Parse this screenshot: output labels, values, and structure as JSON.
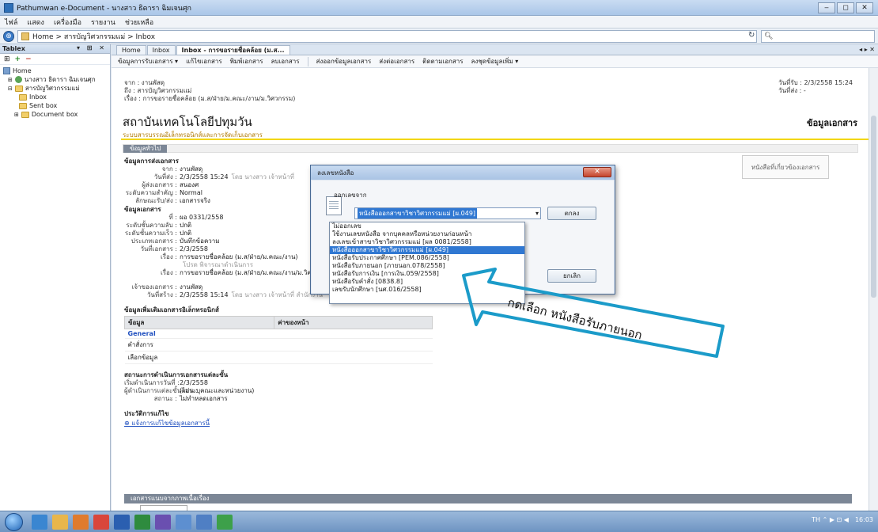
{
  "window": {
    "title": "Pathumwan e-Document - นางสาว ธิดารา ฉิมเจนศุก",
    "controls": [
      "‒",
      "◻",
      "✕"
    ]
  },
  "menubar": [
    "ไฟล์",
    "แสดง",
    "เครื่องมือ",
    "รายงาน",
    "ช่วยเหลือ"
  ],
  "address": {
    "path": "Home > สารบัญวิศวกรรมแม่ > Inbox",
    "search_placeholder": ""
  },
  "leftpane": {
    "header": "Tablex",
    "controls": "▾ ⊞ ✕",
    "toolbar": [
      "⊞",
      "+",
      "−"
    ],
    "tree": [
      {
        "label": "Home",
        "indent": 0,
        "icon": "home-icon"
      },
      {
        "label": "นางสาว ธิดารา ฉิมเจนศุก",
        "indent": 1,
        "icon": "user-icon"
      },
      {
        "label": "สารบัญวิศวกรรมแม่",
        "indent": 1,
        "icon": "folder-icon"
      },
      {
        "label": "Inbox",
        "indent": 2,
        "icon": "folder-icon"
      },
      {
        "label": "Sent box",
        "indent": 2,
        "icon": "folder-icon"
      },
      {
        "label": "Document box",
        "indent": 2,
        "icon": "folder-icon"
      }
    ]
  },
  "tabs": [
    {
      "label": "Home",
      "active": false
    },
    {
      "label": "Inbox",
      "active": false
    },
    {
      "label": "Inbox - การขอรายชื่อคล้อย (ม.ส...",
      "active": true
    }
  ],
  "tab_controls": "◂ ▸ ✕",
  "doctoolbar": [
    "ข้อมูลการรับเอกสาร ▾",
    "แก้ไขเอกสาร",
    "พิมพ์เอกสาร",
    "ลบเอกสาร",
    "ส่งออกข้อมูลเอกสาร",
    "ส่งต่อเอกสาร",
    "ติดตามเอกสาร",
    "ลงชุดข้อมูลเพิ่ม ▾"
  ],
  "meta": {
    "left": [
      "จาก : งานพัสดุ",
      "ถึง : สารบัญวิศวกรรมแม่",
      "เรื่อง : การขอรายชื่อคล้อย (ม.ส/ฝ่าย/ม.คณะ/งาน/ม.วิศวกรรม)"
    ],
    "right": [
      "วันที่รับ : 2/3/2558 15:24",
      "วันที่ส่ง : -"
    ]
  },
  "org": {
    "title": "สถาบันเทคโนโลยีปทุมวัน",
    "subtitle": "ระบบสารบรรณอิเล็กทรอนิกส์และการจัดเก็บเอกสาร",
    "doc_info": "ข้อมูลเอกสาร",
    "section_tag": "ข้อมูลทั่วไป"
  },
  "form": {
    "sec1": "ข้อมูลการส่งเอกสาร",
    "sec1_rows": [
      {
        "label": "จาก :",
        "value": "งานพัสดุ",
        "note": ""
      },
      {
        "label": "วันที่ส่ง :",
        "value": "2/3/2558 15:24",
        "note": "โดย นางสาว เจ้าหน้าที่"
      },
      {
        "label": "ผู้ส่งเอกสาร :",
        "value": "สนองศ",
        "note": ""
      },
      {
        "label": "ระดับความสำคัญ :",
        "value": "Normal",
        "note": ""
      },
      {
        "label": "ลักษณะรับ/ส่ง :",
        "value": "เอกสารจริง",
        "note": ""
      }
    ],
    "sec2": "ข้อมูลเอกสาร",
    "sec2_rows": [
      {
        "label": "ที่ :",
        "value": "ผอ 0331/2558",
        "note": ""
      },
      {
        "label": "ระดับชั้นความลับ :",
        "value": "ปกติ",
        "note": ""
      },
      {
        "label": "ระดับชั้นความเร็ว :",
        "value": "ปกติ",
        "note": ""
      },
      {
        "label": "ประเภทเอกสาร :",
        "value": "บันทึกข้อความ",
        "note": ""
      },
      {
        "label": "วันที่เอกสาร :",
        "value": "2/3/2558",
        "note": ""
      },
      {
        "label": "เรื่อง :",
        "value": "การขอรายชื่อคล้อย (ม.ส/ฝ่าย/ม.คณะ/งาน)",
        "note": ""
      },
      {
        "label": "",
        "value": "",
        "note": "โปรด พิจารณาดำเนินการ"
      },
      {
        "label": "เรื่อง :",
        "value": "การขอรายชื่อคล้อย (ม.ส/ฝ่าย/ม.คณะ/งาน/ม.วิศวกรรม)",
        "note": ""
      }
    ],
    "sec3_rows": [
      {
        "label": "เจ้าของเอกสาร :",
        "value": "งานพัสดุ",
        "note": ""
      },
      {
        "label": "วันที่สร้าง :",
        "value": "2/3/2558 15:14",
        "note": "โดย นางสาว เจ้าหน้าที่ สำนักงาน"
      }
    ],
    "sec4": "ข้อมูลเพิ่มเติมเอกสารอิเล็กทรอนิกส์",
    "table_headers": [
      "ข้อมูล",
      "ค่าของหน้า"
    ],
    "table_rows": [
      "General",
      "คำสั่งการ",
      "เลือกข้อมูล"
    ],
    "sec5": "สถานะการดำเนินการเอกสารแต่ละขั้น",
    "sec5_rows": [
      {
        "label": "เริ่มดำเนินการวันที่ :",
        "value": "2/3/2558"
      },
      {
        "label": "ผู้ดำเนินการแต่ละขั้นตอน :",
        "value": "(ไม่ระบุคณะและหน่วยงาน)"
      },
      {
        "label": "สถานะ :",
        "value": "ไม่ทำหลดเอกสาร"
      }
    ],
    "sec6": "ประวัติการแก้ไข",
    "sec6_link": "⊕ แจ้งการแก้ไขข้อมูลเอกสารนี้",
    "bottom_bar": "เอกสารแนบจากภาพเนื้อเรื่อง",
    "attach_button": "หนังสือที่เกี่ยวข้องเอกสาร"
  },
  "dialog": {
    "title": "ลงเลขหนังสือ",
    "close": "✕",
    "label": "ออกเลขจาก",
    "selected": "หนังสือออกสาขาวิชาวิศวกรรมแม่ [ผ.049]",
    "ok": "ตกลง",
    "cancel": "ยกเลิก"
  },
  "dropdown_options": [
    "ไม่ออกเลข",
    "ใช้งานเลขหนังสือ จากบุคคลหรือหน่วยงานก่อนหน้า",
    "ลงเลขเข้าสาขาวิชาวิศวกรรมแม่ [ผล 0081/2558]",
    "หนังสือออกสาขาวิชาวิศวกรรมแม่ [ผ.049]",
    "หนังสือรับประกาศศึกษา [PEM.086/2558]",
    "หนังสือรับภายนอก [ภายนอก.078/2558]",
    "หนังสือรับการเงิน [การเงิน.059/2558]",
    "หนังสือรับคำสั่ง [0838.8]",
    "เลขรับนักศึกษา [นศ.016/2558]"
  ],
  "dropdown_selected_index": 3,
  "annotation": {
    "text": "กดเลือก หนังสือรับภายนอก",
    "color": "#1b9bc9"
  },
  "taskbar": {
    "tray_text": "TH ⌃ ▶ ⊡ ◀",
    "clock": "16:03"
  },
  "colors": {
    "accent": "#3078d2",
    "org_sub": "#b07a00",
    "yellow_rule": "#f2d600"
  }
}
